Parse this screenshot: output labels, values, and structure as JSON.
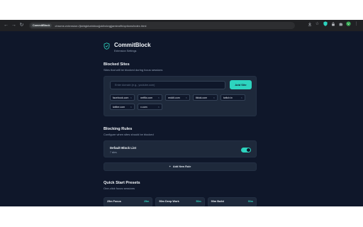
{
  "browser": {
    "tab_chip": "CommitBlock",
    "url": "chrome-extension://jlahtgkhahkbocjjoklbdcrgjjamieaifh/options/index.html"
  },
  "header": {
    "title": "CommitBlock",
    "subtitle": "Extension Settings",
    "icon": "shield-check-icon"
  },
  "blocked_sites": {
    "title": "Blocked Sites",
    "subtitle": "Sites that will be blocked during focus sessions",
    "input_placeholder": "Enter domain (e.g., youtube.com)",
    "add_label": "Add Site",
    "sites": [
      "facebook.com",
      "netflix.com",
      "reddit.com",
      "tiktok.com",
      "twitch.tv",
      "twitter.com",
      "x.com"
    ]
  },
  "blocking_rules": {
    "title": "Blocking Rules",
    "subtitle": "Configure when sites should be blocked",
    "rules": [
      {
        "name": "Default Block List",
        "count": "7 sites",
        "enabled": true
      }
    ],
    "add_rule_label": "Add New Rule"
  },
  "quick_start": {
    "title": "Quick Start Presets",
    "subtitle": "One-click focus sessions",
    "presets": [
      {
        "name": "25m Focus",
        "time": "25m"
      },
      {
        "name": "50m Deep Work",
        "time": "50m"
      },
      {
        "name": "90m Build",
        "time": "90m"
      }
    ]
  },
  "colors": {
    "accent": "#2dd4bf",
    "page_bg": "#0f172a",
    "card_bg": "#1e293b"
  }
}
